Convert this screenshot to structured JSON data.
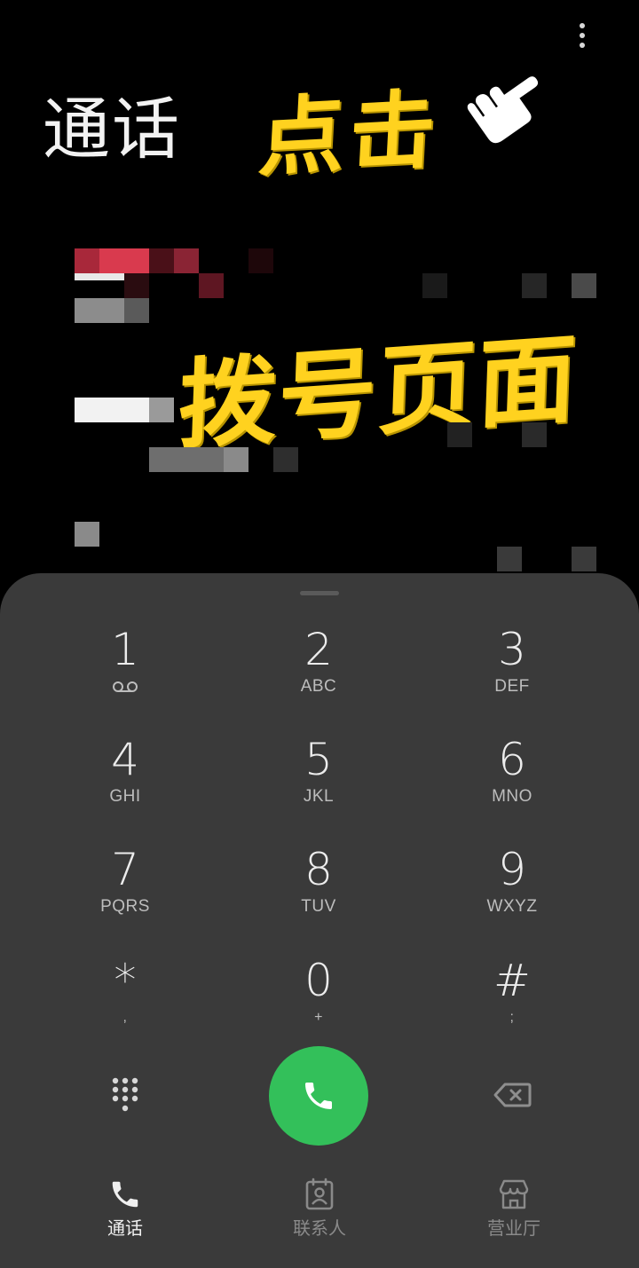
{
  "header": {
    "title": "通话",
    "more_icon": "more-vertical-icon"
  },
  "annotations": {
    "click_text": "点击",
    "dial_page_text": "拨号页面",
    "hand_icon": "pointing-hand-icon",
    "color": "#ffd21f"
  },
  "dialpad": {
    "keys": [
      {
        "digit": "1",
        "letters": "",
        "icon": "voicemail-icon"
      },
      {
        "digit": "2",
        "letters": "ABC"
      },
      {
        "digit": "3",
        "letters": "DEF"
      },
      {
        "digit": "4",
        "letters": "GHI"
      },
      {
        "digit": "5",
        "letters": "JKL"
      },
      {
        "digit": "6",
        "letters": "MNO"
      },
      {
        "digit": "7",
        "letters": "PQRS"
      },
      {
        "digit": "8",
        "letters": "TUV"
      },
      {
        "digit": "9",
        "letters": "WXYZ"
      },
      {
        "digit": "*",
        "letters": ","
      },
      {
        "digit": "0",
        "letters": "+"
      },
      {
        "digit": "#",
        "letters": ";"
      }
    ],
    "grid_icon": "dialpad-grid-icon",
    "call_icon": "phone-icon",
    "backspace_icon": "backspace-icon",
    "call_color": "#33c05a"
  },
  "bottom_nav": {
    "items": [
      {
        "label": "通话",
        "icon": "phone-icon",
        "active": true
      },
      {
        "label": "联系人",
        "icon": "contacts-icon",
        "active": false
      },
      {
        "label": "营业厅",
        "icon": "store-icon",
        "active": false
      }
    ]
  },
  "colors": {
    "background": "#000000",
    "sheet": "#3a3a3a",
    "accent_call": "#33c05a"
  }
}
